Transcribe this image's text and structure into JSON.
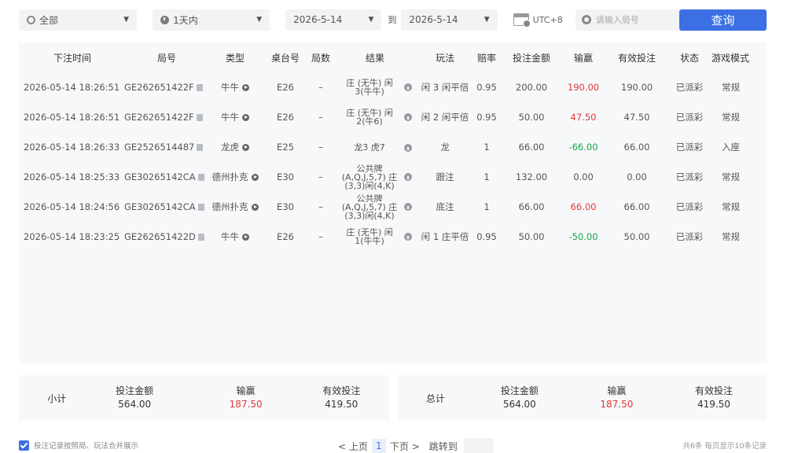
{
  "filters": {
    "category": "全部",
    "time_range": "1天内",
    "start_date": "2026-5-14",
    "to_label": "到",
    "end_date": "2026-5-14",
    "timezone": "UTC+8",
    "search_placeholder": "请输入局号",
    "query_label": "查询"
  },
  "table": {
    "headers": {
      "time": "下注时间",
      "round": "局号",
      "type": "类型",
      "table_no": "桌台号",
      "rounds": "局数",
      "result": "结果",
      "play": "玩法",
      "odds": "赔率",
      "bet": "投注金额",
      "winloss": "输赢",
      "valid": "有效投注",
      "status": "状态",
      "mode": "游戏模式"
    },
    "rows": [
      {
        "time": "2026-05-14 18:26:51",
        "round": "GE262651422F",
        "type": "牛牛",
        "table_no": "E26",
        "rounds": "–",
        "result": "庄 (无牛) 闲3(牛牛)",
        "play": "闲 3 闲平倍",
        "odds": "0.95",
        "bet": "200.00",
        "winloss": "190.00",
        "winloss_color": "red",
        "valid": "190.00",
        "status": "已派彩",
        "mode": "常规"
      },
      {
        "time": "2026-05-14 18:26:51",
        "round": "GE262651422F",
        "type": "牛牛",
        "table_no": "E26",
        "rounds": "–",
        "result": "庄 (无牛) 闲2(牛6)",
        "play": "闲 2 闲平倍",
        "odds": "0.95",
        "bet": "50.00",
        "winloss": "47.50",
        "winloss_color": "red",
        "valid": "47.50",
        "status": "已派彩",
        "mode": "常规"
      },
      {
        "time": "2026-05-14 18:26:33",
        "round": "GE2526514487",
        "type": "龙虎",
        "table_no": "E25",
        "rounds": "–",
        "result": "龙3 虎7",
        "play": "龙",
        "odds": "1",
        "bet": "66.00",
        "winloss": "-66.00",
        "winloss_color": "green",
        "valid": "66.00",
        "status": "已派彩",
        "mode": "入座"
      },
      {
        "time": "2026-05-14 18:25:33",
        "round": "GE30265142CA",
        "type": "德州扑克",
        "table_no": "E30",
        "rounds": "–",
        "result": "公共牌 (A,Q,J,5,7) 庄(3,3)闲(4,K)",
        "play": "跟注",
        "odds": "1",
        "bet": "132.00",
        "winloss": "0.00",
        "winloss_color": "plain",
        "valid": "0.00",
        "status": "已派彩",
        "mode": "常规"
      },
      {
        "time": "2026-05-14 18:24:56",
        "round": "GE30265142CA",
        "type": "德州扑克",
        "table_no": "E30",
        "rounds": "–",
        "result": "公共牌 (A,Q,J,5,7) 庄(3,3)闲(4,K)",
        "play": "底注",
        "odds": "1",
        "bet": "66.00",
        "winloss": "66.00",
        "winloss_color": "red",
        "valid": "66.00",
        "status": "已派彩",
        "mode": "常规"
      },
      {
        "time": "2026-05-14 18:23:25",
        "round": "GE262651422D",
        "type": "牛牛",
        "table_no": "E26",
        "rounds": "–",
        "result": "庄 (无牛) 闲1(牛牛)",
        "play": "闲 1 庄平倍",
        "odds": "0.95",
        "bet": "50.00",
        "winloss": "-50.00",
        "winloss_color": "green",
        "valid": "50.00",
        "status": "已派彩",
        "mode": "常规"
      }
    ]
  },
  "summary": {
    "subtotal_label": "小计",
    "total_label": "总计",
    "bet_label": "投注金额",
    "winloss_label": "输赢",
    "valid_label": "有效投注",
    "subtotal": {
      "bet": "564.00",
      "winloss": "187.50",
      "valid": "419.50"
    },
    "total": {
      "bet": "564.00",
      "winloss": "187.50",
      "valid": "419.50"
    }
  },
  "footer": {
    "merge_label": "投注记录按照局、玩法合并展示",
    "prev_label": "< 上页",
    "current_page": "1",
    "next_label": "下页 >",
    "jump_label": "跳转到",
    "records_info": "共6条  每页显示10条记录"
  },
  "colors": {
    "accent": "#3b6fe3",
    "win": "#e03a3a",
    "loss": "#17a34a"
  }
}
